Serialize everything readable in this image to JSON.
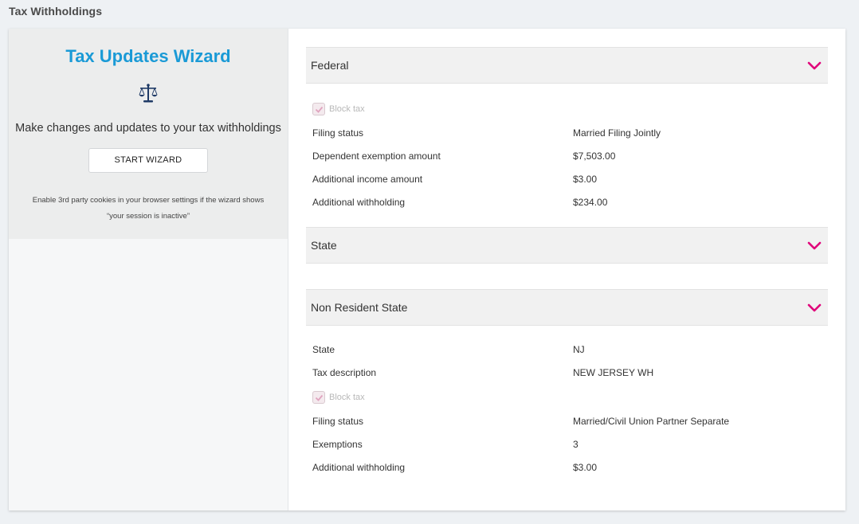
{
  "page": {
    "title": "Tax Withholdings"
  },
  "wizard": {
    "title": "Tax Updates Wizard",
    "icon": "scales-icon",
    "description": "Make changes and updates to your tax withholdings",
    "button_label": "START WIZARD",
    "note_line1": "Enable 3rd party cookies in your browser settings if the wizard shows",
    "note_line2": "“your session is inactive”"
  },
  "colors": {
    "accent": "#1a9ad6",
    "chevron": "#e0007a",
    "icon": "#1f3a66"
  },
  "federal": {
    "title": "Federal",
    "block_tax_label": "Block tax",
    "block_tax_checked": true,
    "rows": [
      {
        "label": "Filing status",
        "value": "Married Filing Jointly"
      },
      {
        "label": "Dependent exemption amount",
        "value": "$7,503.00"
      },
      {
        "label": "Additional income amount",
        "value": "$3.00"
      },
      {
        "label": "Additional withholding",
        "value": "$234.00"
      }
    ]
  },
  "state": {
    "title": "State"
  },
  "non_resident_state": {
    "title": "Non Resident State",
    "rows_top": [
      {
        "label": "State",
        "value": "NJ"
      },
      {
        "label": "Tax description",
        "value": "NEW JERSEY WH"
      }
    ],
    "block_tax_label": "Block tax",
    "block_tax_checked": true,
    "rows_bottom": [
      {
        "label": "Filing status",
        "value": "Married/Civil Union Partner Separate"
      },
      {
        "label": "Exemptions",
        "value": "3"
      },
      {
        "label": "Additional withholding",
        "value": "$3.00"
      }
    ]
  }
}
